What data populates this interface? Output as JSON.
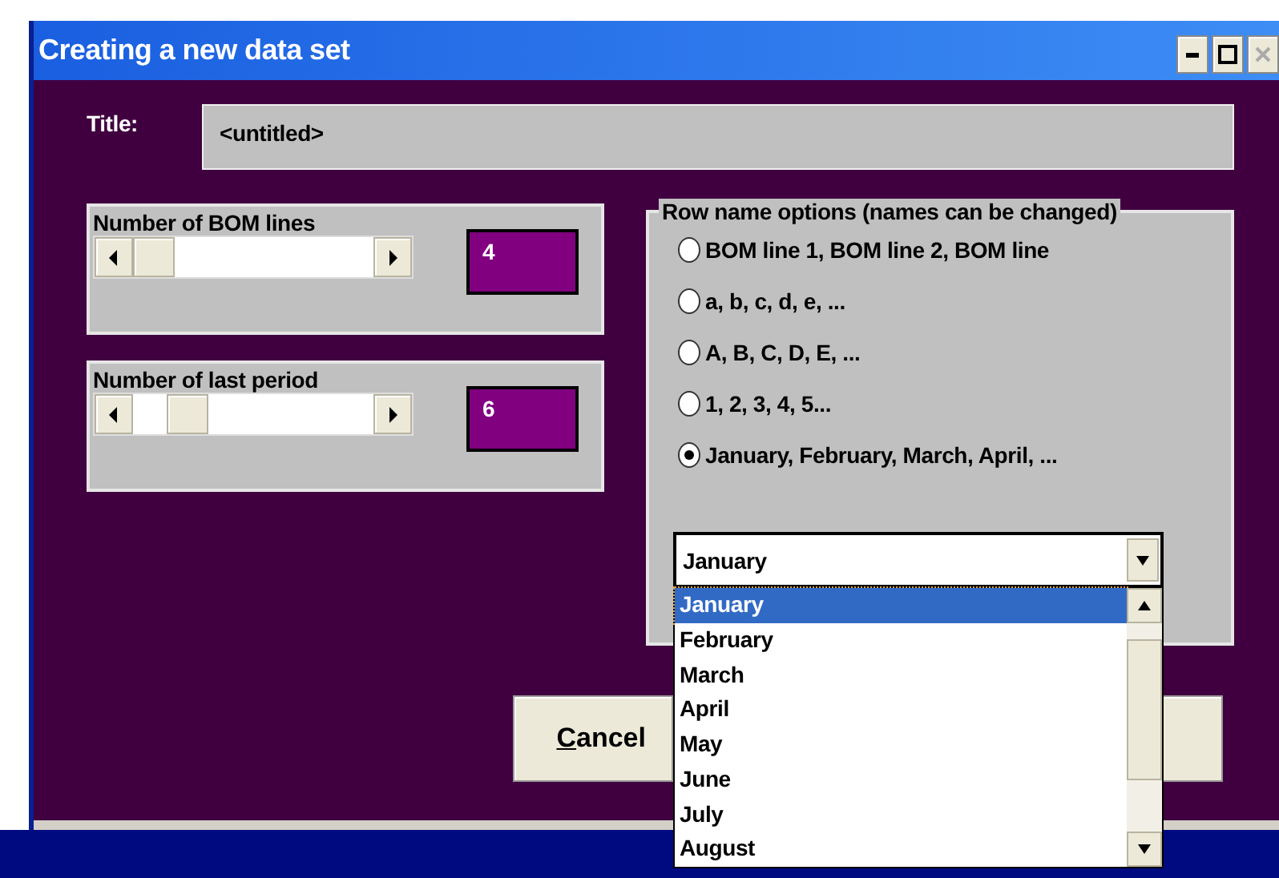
{
  "window": {
    "title": "Creating a new data set",
    "controls": [
      {
        "kind": "minimize",
        "disabled": false
      },
      {
        "kind": "maximize",
        "disabled": false
      },
      {
        "kind": "close",
        "disabled": true
      }
    ]
  },
  "title_field": {
    "label": "Title:",
    "value": "<untitled>"
  },
  "sliders": [
    {
      "label": "Number of BOM lines",
      "level": 0,
      "value": "4"
    },
    {
      "label": "Number of last period",
      "level": 0.17,
      "value": "6"
    }
  ],
  "row_name_options": {
    "legend": "Row name options (names can be changed)",
    "options": [
      {
        "label": "BOM line 1, BOM line 2, BOM line",
        "selected": false
      },
      {
        "label": "a, b, c, d, e, ...",
        "selected": false
      },
      {
        "label": "A, B, C, D, E, ...",
        "selected": false
      },
      {
        "label": "1, 2, 3, 4, 5...",
        "selected": false
      },
      {
        "label": "January, February, March, April, ...",
        "selected": true
      }
    ]
  },
  "combo": {
    "value": "January",
    "items": [
      {
        "label": "January",
        "selected": true
      },
      {
        "label": "February",
        "selected": false
      },
      {
        "label": "March",
        "selected": false
      },
      {
        "label": "April",
        "selected": false
      },
      {
        "label": "May",
        "selected": false
      },
      {
        "label": "June",
        "selected": false
      },
      {
        "label": "July",
        "selected": false
      },
      {
        "label": "August",
        "selected": false
      }
    ]
  },
  "buttons": [
    {
      "label": "Cancel"
    }
  ]
}
